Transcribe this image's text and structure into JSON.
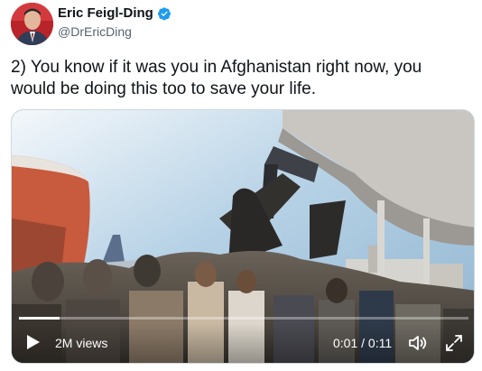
{
  "author": {
    "display_name": "Eric Feigl-Ding",
    "handle": "@DrEricDing",
    "verified_icon": "verified-badge-icon",
    "badge_color": "#1d9bf0"
  },
  "tweet": {
    "text": "2) You know if it was you in Afghanistan right now, you would be doing this too to save your life."
  },
  "video": {
    "views": "2M views",
    "time": "0:01 / 0:11",
    "progress": 0.09,
    "play_icon": "play-icon",
    "volume_icon": "volume-icon",
    "fullscreen_icon": "fullscreen-icon"
  }
}
